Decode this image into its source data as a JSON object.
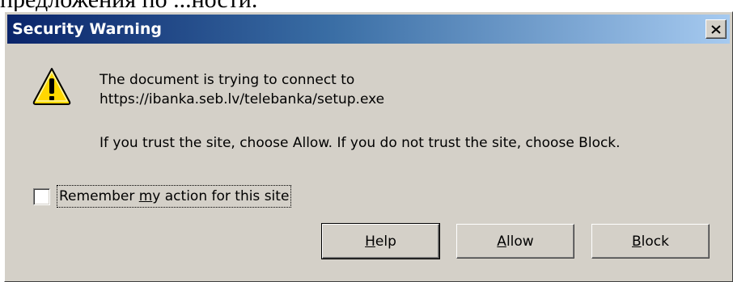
{
  "background": {
    "text": "предложения по ...ности."
  },
  "dialog": {
    "title": "Security Warning",
    "close_label": "Close",
    "message_line1": "The document is trying to connect to",
    "message_line2": "https://ibanka.seb.lv/telebanka/setup.exe",
    "message_line3": "If you trust the site, choose Allow. If you do not trust the site, choose Block.",
    "remember": {
      "label_before": "Remember ",
      "label_underlined": "m",
      "label_after": "y action for this site",
      "checked": false
    },
    "buttons": {
      "help": {
        "underlined": "H",
        "rest": "elp"
      },
      "allow": {
        "underlined": "A",
        "rest": "llow"
      },
      "block": {
        "underlined": "B",
        "rest": "lock"
      }
    },
    "icon": "warning-triangle-icon",
    "colors": {
      "face": "#d4d0c8",
      "title_start": "#0a246a",
      "title_end": "#a6caf0",
      "icon_fill": "#ffd700"
    }
  }
}
